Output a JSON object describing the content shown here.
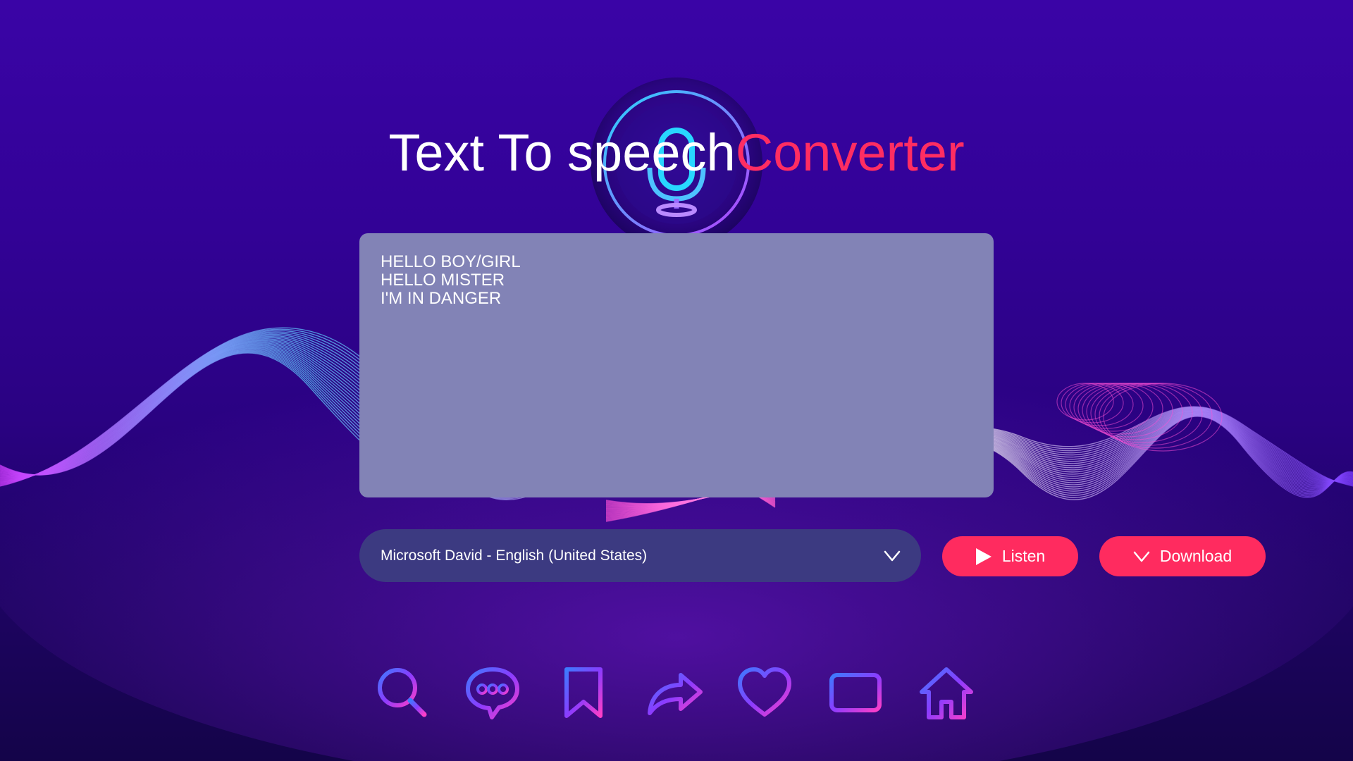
{
  "header": {
    "title_part1": "Text To speech",
    "title_part2": "Converter"
  },
  "editor": {
    "lines": [
      "HELLO BOY/GIRL",
      "HELLO MISTER",
      "I'M IN DANGER"
    ]
  },
  "voice_select": {
    "selected": "Microsoft David - English (United States)"
  },
  "actions": {
    "listen_label": "Listen",
    "download_label": "Download"
  },
  "bottom_nav": {
    "icons": [
      "search-icon",
      "chat-icon",
      "bookmark-icon",
      "share-icon",
      "heart-icon",
      "add-icon",
      "home-icon"
    ]
  },
  "colors": {
    "background": "#3a04a6",
    "accent": "#ff2b5f",
    "textarea": "#8283b6",
    "select": "#3c3a81"
  }
}
